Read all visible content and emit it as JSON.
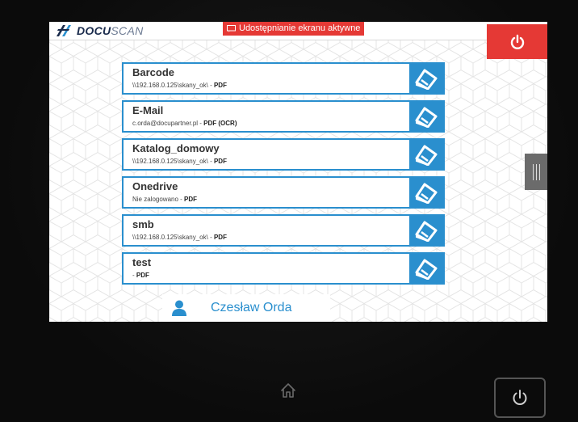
{
  "app": {
    "logo_bold": "DOCU",
    "logo_light": "SCAN",
    "share_badge": "Udostępnianie ekranu aktywne"
  },
  "profiles": [
    {
      "name": "Barcode",
      "path": "\\\\192.168.0.125\\skany_ok\\",
      "sep": " - ",
      "format": "PDF"
    },
    {
      "name": "E-Mail",
      "path": "c.orda@docupartner.pl",
      "sep": " - ",
      "format": "PDF (OCR)"
    },
    {
      "name": "Katalog_domowy",
      "path": "\\\\192.168.0.125\\skany_ok\\",
      "sep": " - ",
      "format": "PDF"
    },
    {
      "name": "Onedrive",
      "path": "Nie zalogowano",
      "sep": " - ",
      "format": "PDF"
    },
    {
      "name": "smb",
      "path": "\\\\192.168.0.125\\skany_ok\\",
      "sep": " - ",
      "format": "PDF"
    },
    {
      "name": "test",
      "path": "",
      "sep": " - ",
      "format": "PDF"
    }
  ],
  "user": {
    "name": "Czesław Orda"
  },
  "colors": {
    "accent": "#2a8fce",
    "danger": "#e53935",
    "brand_dark": "#1a2b4c"
  },
  "icons": {
    "power": "power-icon",
    "scan": "scanner-icon",
    "user": "user-icon",
    "home": "home-icon",
    "share": "screen-share-icon",
    "handle": "drawer-handle-icon"
  }
}
